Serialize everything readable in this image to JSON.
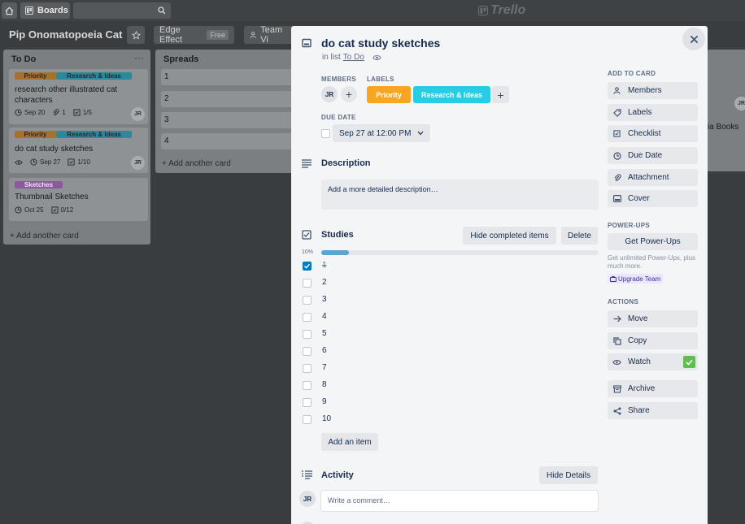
{
  "topbar": {
    "home_icon": "home-icon",
    "boards_label": "Boards",
    "search_icon": "search-icon",
    "logo_text": "Trello"
  },
  "board": {
    "title": "Pip Onomatopoeia Cat",
    "edge_effect_label": "Edge Effect",
    "free_badge": "Free",
    "team_label": "Team Vi"
  },
  "lists": {
    "todo": {
      "title": "To Do",
      "cards": [
        {
          "labels": [
            "Priority",
            "Research & Ideas"
          ],
          "title": "research other illustrated cat characters",
          "due": "Sep 20",
          "attachments": "1",
          "checklist": "1/5",
          "member": "JR"
        },
        {
          "labels": [
            "Priority",
            "Research & Ideas"
          ],
          "title": "do cat study sketches",
          "due": "Sep 27",
          "checklist": "1/10",
          "member": "JR"
        },
        {
          "labels": [
            "Sketches"
          ],
          "title": "Thumbnail Sketches",
          "due": "Oct 25",
          "checklist": "0/12"
        }
      ],
      "add_card": "+ Add another card"
    },
    "spreads": {
      "title": "Spreads",
      "cards": [
        "1",
        "2",
        "3",
        "4"
      ],
      "add_card": "+ Add another card"
    },
    "right": {
      "partial_text": "ia Books",
      "partial_member": "JR"
    }
  },
  "modal": {
    "title": "do cat study sketches",
    "in_list_prefix": "in list",
    "in_list_name": "To Do",
    "members_header": "MEMBERS",
    "labels_header": "LABELS",
    "member": "JR",
    "labels": [
      {
        "name": "Priority",
        "color": "#f6a623"
      },
      {
        "name": "Research & Ideas",
        "color": "#29cce5"
      }
    ],
    "due_header": "DUE DATE",
    "due_value": "Sep 27 at 12:00 PM",
    "description_title": "Description",
    "description_placeholder": "Add a more detailed description…",
    "checklist_title": "Studies",
    "hide_completed": "Hide completed items",
    "delete_label": "Delete",
    "progress_label": "10%",
    "progress": 0.1,
    "items": [
      {
        "text": "1",
        "done": true
      },
      {
        "text": "2",
        "done": false
      },
      {
        "text": "3",
        "done": false
      },
      {
        "text": "4",
        "done": false
      },
      {
        "text": "5",
        "done": false
      },
      {
        "text": "6",
        "done": false
      },
      {
        "text": "7",
        "done": false
      },
      {
        "text": "8",
        "done": false
      },
      {
        "text": "9",
        "done": false
      },
      {
        "text": "10",
        "done": false
      }
    ],
    "add_item": "Add an item",
    "activity_title": "Activity",
    "hide_details": "Hide Details",
    "comment_member": "JR",
    "comment_placeholder": "Write a comment…"
  },
  "sidebar": {
    "add_to_card_header": "ADD TO CARD",
    "add_buttons": [
      "Members",
      "Labels",
      "Checklist",
      "Due Date",
      "Attachment",
      "Cover"
    ],
    "powerups_header": "POWER-UPS",
    "get_powerups": "Get Power-Ups",
    "powerups_note": "Get unlimited Power-Ups, plus much more.",
    "upgrade_team": "Upgrade Team",
    "actions_header": "ACTIONS",
    "action_buttons": [
      "Move",
      "Copy",
      "Watch"
    ],
    "archive_buttons": [
      "Archive",
      "Share"
    ]
  },
  "colors": {
    "priority": "#f6a623",
    "research": "#29cce5",
    "sketches": "#c377e0",
    "check_blue": "#0079bf",
    "progress_blue": "#5ba4cf",
    "watch_green": "#61bd4f"
  }
}
